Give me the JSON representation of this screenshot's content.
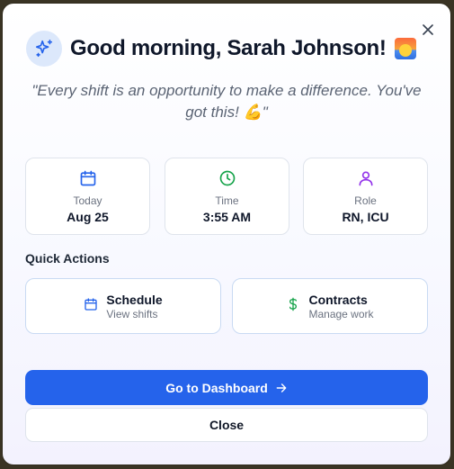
{
  "greeting": {
    "title": "Good morning, Sarah Johnson!",
    "quote": "\"Every shift is an opportunity to make a difference. You've got this! 💪\""
  },
  "stats": [
    {
      "icon": "calendar-icon",
      "label": "Today",
      "value": "Aug 25",
      "color": "#2563eb"
    },
    {
      "icon": "clock-icon",
      "label": "Time",
      "value": "3:55 AM",
      "color": "#16a34a"
    },
    {
      "icon": "user-icon",
      "label": "Role",
      "value": "RN, ICU",
      "color": "#9333ea"
    }
  ],
  "quick_actions": {
    "title": "Quick Actions",
    "items": [
      {
        "icon": "calendar-icon",
        "title": "Schedule",
        "subtitle": "View shifts",
        "color": "#2563eb"
      },
      {
        "icon": "dollar-icon",
        "title": "Contracts",
        "subtitle": "Manage work",
        "color": "#16a34a"
      }
    ]
  },
  "buttons": {
    "primary": "Go to Dashboard",
    "secondary": "Close"
  },
  "colors": {
    "accent": "#2563eb",
    "green": "#16a34a",
    "purple": "#9333ea"
  }
}
